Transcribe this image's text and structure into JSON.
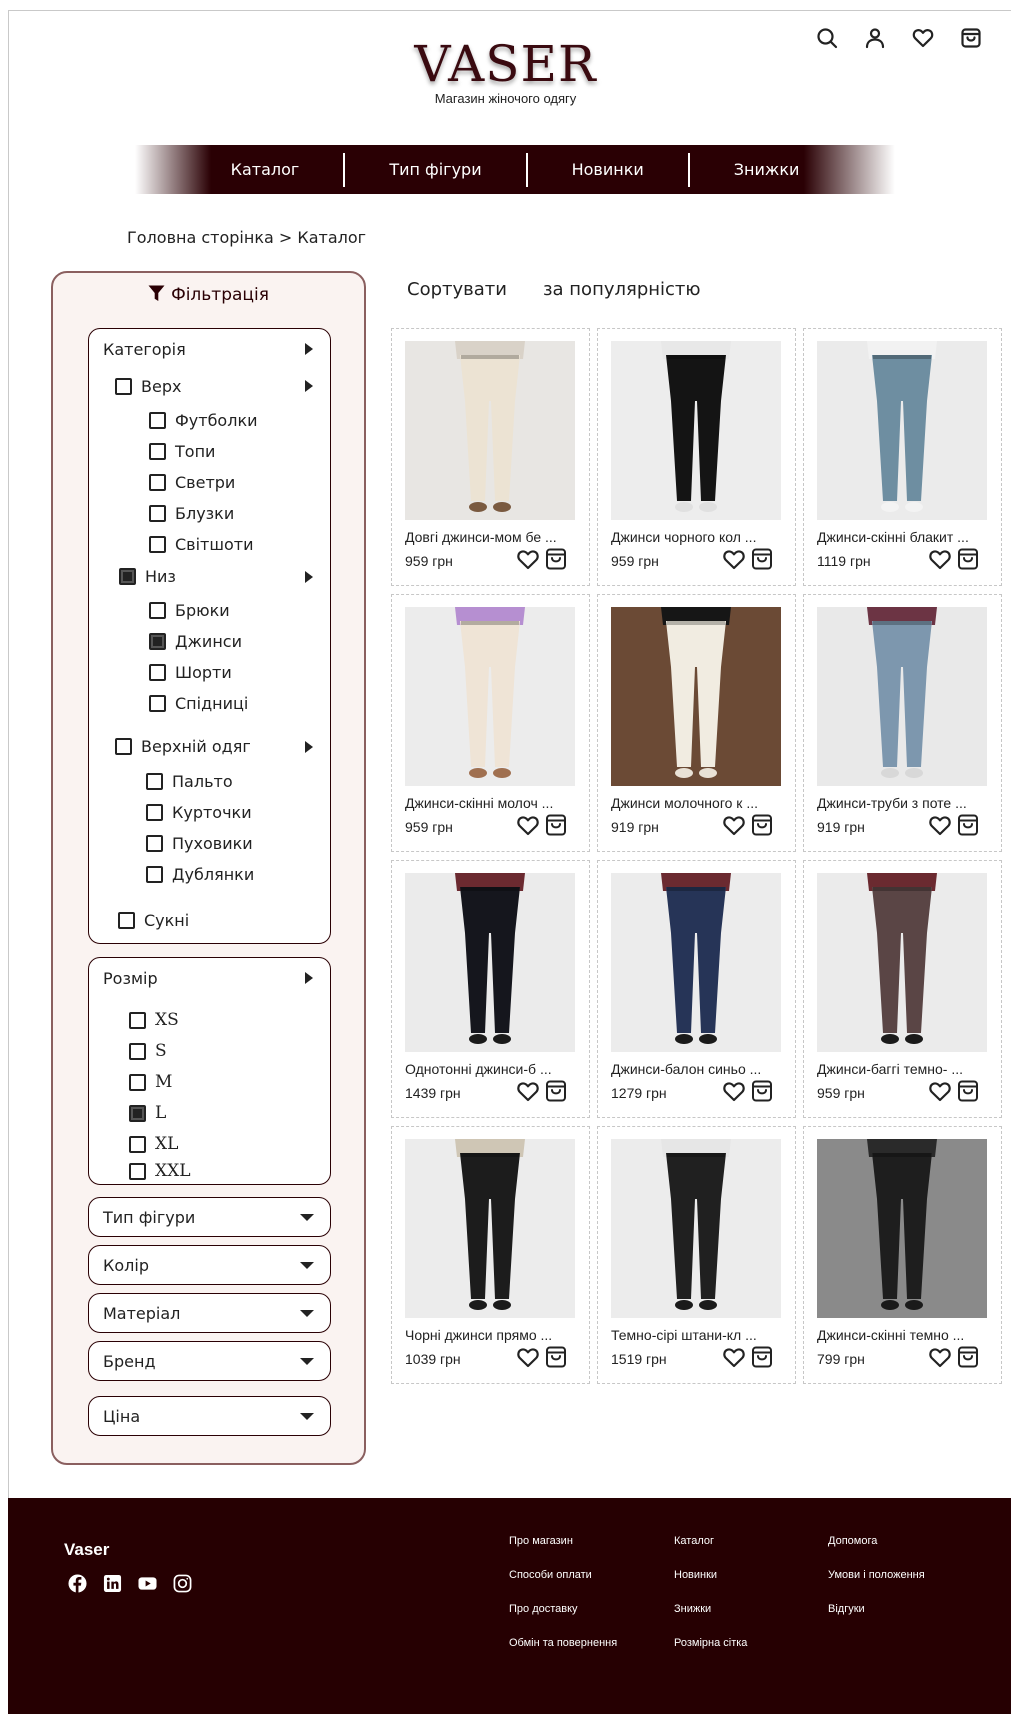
{
  "header": {
    "logo": "VASER",
    "tagline": "Магазин жіночого одягу",
    "icons": [
      "search-icon",
      "user-icon",
      "heart-icon",
      "bag-icon"
    ]
  },
  "nav": {
    "items": [
      "Каталог",
      "Тип фігури",
      "Новинки",
      "Знижки"
    ]
  },
  "breadcrumb": "Головна сторінка > Каталог",
  "filter": {
    "title": "Фільтрація",
    "category": {
      "label": "Категорія",
      "groups": [
        {
          "label": "Верх",
          "checked": false,
          "items": [
            {
              "label": "Футболки",
              "checked": false
            },
            {
              "label": "Топи",
              "checked": false
            },
            {
              "label": "Светри",
              "checked": false
            },
            {
              "label": "Блузки",
              "checked": false
            },
            {
              "label": "Світшоти",
              "checked": false
            }
          ]
        },
        {
          "label": "Низ",
          "checked": true,
          "items": [
            {
              "label": "Брюки",
              "checked": false
            },
            {
              "label": "Джинси",
              "checked": true
            },
            {
              "label": "Шорти",
              "checked": false
            },
            {
              "label": "Спідниці",
              "checked": false
            }
          ]
        },
        {
          "label": "Верхній одяг",
          "checked": false,
          "items": [
            {
              "label": "Пальто",
              "checked": false
            },
            {
              "label": "Курточки",
              "checked": false
            },
            {
              "label": "Пуховики",
              "checked": false
            },
            {
              "label": "Дублянки",
              "checked": false
            }
          ]
        },
        {
          "label": "Сукні",
          "checked": false,
          "items": []
        }
      ]
    },
    "size": {
      "label": "Розмір",
      "items": [
        {
          "label": "XS",
          "checked": false
        },
        {
          "label": "S",
          "checked": false
        },
        {
          "label": "M",
          "checked": false
        },
        {
          "label": "L",
          "checked": true
        },
        {
          "label": "XL",
          "checked": false
        },
        {
          "label": "XXL",
          "checked": false
        }
      ]
    },
    "dropdowns": [
      "Тип фігури",
      "Колір",
      "Матеріал",
      "Бренд",
      "Ціна"
    ]
  },
  "sort": {
    "label": "Сортувати",
    "value": "за популярністю"
  },
  "products": [
    {
      "name": "Довгі джинси-мом бе ...",
      "price": "959 грн",
      "bg": "#e8e6e3",
      "pants": "#ece3d3",
      "top": "#d9d2c8",
      "shoe": "#7a5a40"
    },
    {
      "name": "Джинси чорного кол ...",
      "price": "959 грн",
      "bg": "#ededed",
      "pants": "#141414",
      "top": "#e8e8e8",
      "shoe": "#e0e0e0"
    },
    {
      "name": "Джинси-скінні блакит ...",
      "price": "1119 грн",
      "bg": "#ebebeb",
      "pants": "#6e8ea1",
      "top": "#f2f2f2",
      "shoe": "#f3f3f3"
    },
    {
      "name": "Джинси-скінні молоч ...",
      "price": "959 грн",
      "bg": "#ececec",
      "pants": "#efe4d6",
      "top": "#b68fd1",
      "shoe": "#a07050"
    },
    {
      "name": "Джинси молочного к ...",
      "price": "919 грн",
      "bg": "#6b4a35",
      "pants": "#f1ece1",
      "top": "#161616",
      "shoe": "#e9e2d6"
    },
    {
      "name": "Джинси-труби з поте ...",
      "price": "919 грн",
      "bg": "#e9e9e9",
      "pants": "#7d97ae",
      "top": "#6c3444",
      "shoe": "#d8d8d8"
    },
    {
      "name": "Однотонні джинси-б ...",
      "price": "1439 грн",
      "bg": "#ebebeb",
      "pants": "#15161d",
      "top": "#6b2a30",
      "shoe": "#1a1a1a"
    },
    {
      "name": "Джинси-балон синьо ...",
      "price": "1279 грн",
      "bg": "#ececec",
      "pants": "#263457",
      "top": "#6b2a30",
      "shoe": "#1a1a1a"
    },
    {
      "name": "Джинси-баггі темно- ...",
      "price": "959 грн",
      "bg": "#ebebeb",
      "pants": "#5a4545",
      "top": "#6b2a30",
      "shoe": "#1a1a1a"
    },
    {
      "name": "Чорні джинси прямо ...",
      "price": "1039 грн",
      "bg": "#ececec",
      "pants": "#1c1c1c",
      "top": "#cfc6b5",
      "shoe": "#1a1a1a"
    },
    {
      "name": "Темно-сірі штани-кл ...",
      "price": "1519 грн",
      "bg": "#ececec",
      "pants": "#202020",
      "top": "#e6e6e6",
      "shoe": "#1a1a1a"
    },
    {
      "name": "Джинси-скінні темно ...",
      "price": "799 грн",
      "bg": "#8a8a8a",
      "pants": "#1e1e1e",
      "top": "#2a2a2a",
      "shoe": "#1a1a1a"
    }
  ],
  "footer": {
    "brand": "Vaser",
    "social": [
      "facebook-icon",
      "linkedin-icon",
      "youtube-icon",
      "instagram-icon"
    ],
    "columns": [
      [
        "Про магазин",
        "Способи оплати",
        "Про доставку",
        "Обмін та повернення"
      ],
      [
        "Каталог",
        "Новинки",
        "Знижки",
        "Розмірна сітка"
      ],
      [
        "Допомога",
        "Умови і положення",
        "Відгуки"
      ]
    ]
  },
  "colors": {
    "brand": "#2a0004",
    "filter_border": "#8a5f5f",
    "filter_bg": "#faf3f1",
    "footer_bg": "#260002"
  }
}
